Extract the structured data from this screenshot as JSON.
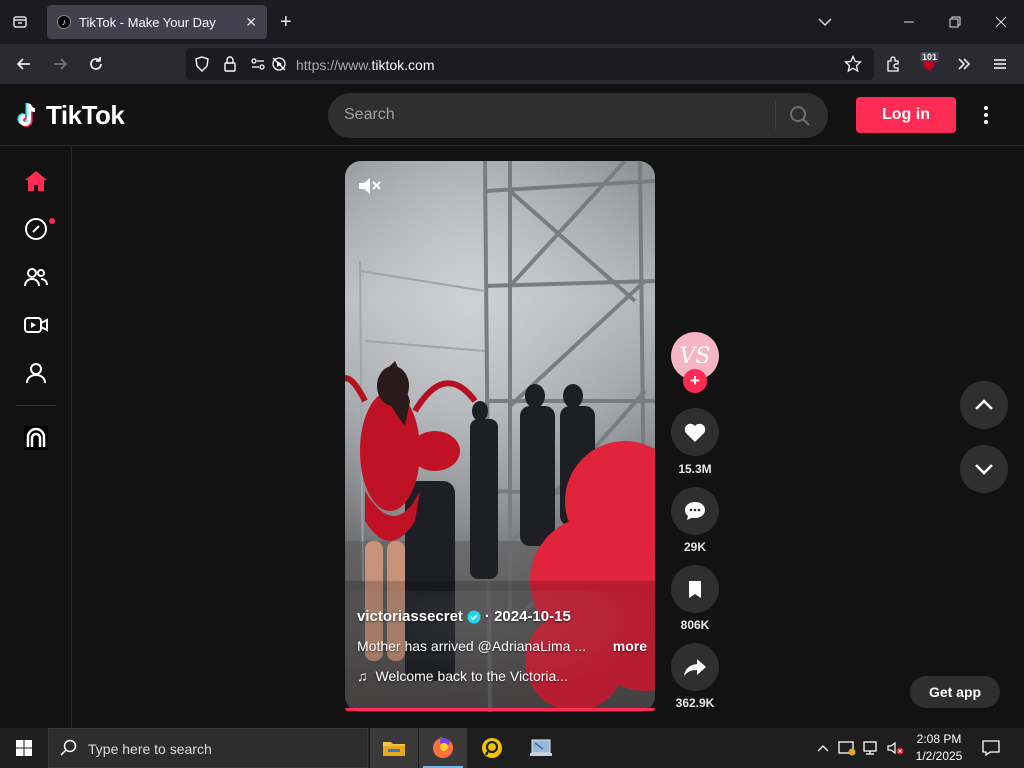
{
  "browser": {
    "tab_title": "TikTok - Make Your Day",
    "url_prefix": "https://www.",
    "url_domain": "tiktok.com",
    "extension_badge": "101"
  },
  "tiktok": {
    "logo_text": "TikTok",
    "search_placeholder": "Search",
    "login_label": "Log in",
    "get_app_label": "Get app",
    "brand_color": "#fe2c55"
  },
  "video": {
    "author": "victoriassecret",
    "date": "· 2024-10-15",
    "description": "Mother has arrived @AdrianaLima ...",
    "more_label": "more",
    "music": "Welcome back to the Victoria...",
    "avatar_initials": "VS"
  },
  "actions": {
    "likes": "15.3M",
    "comments": "29K",
    "saves": "806K",
    "shares": "362.9K"
  },
  "taskbar": {
    "search_placeholder": "Type here to search",
    "time": "2:08 PM",
    "date": "1/2/2025"
  }
}
